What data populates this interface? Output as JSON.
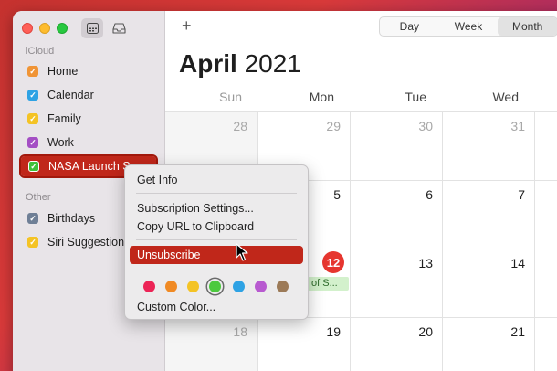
{
  "sidebar": {
    "sections": [
      {
        "title": "iCloud",
        "items": [
          {
            "label": "Home",
            "color": "#f09436"
          },
          {
            "label": "Calendar",
            "color": "#2ea2e4"
          },
          {
            "label": "Family",
            "color": "#f4c325"
          },
          {
            "label": "Work",
            "color": "#a44ec4"
          },
          {
            "label": "NASA Launch S",
            "color": "#3fc13b",
            "selected": true
          }
        ]
      },
      {
        "title": "Other",
        "items": [
          {
            "label": "Birthdays",
            "color": "#6f7f96"
          },
          {
            "label": "Siri Suggestion",
            "color": "#f4c325"
          }
        ]
      }
    ]
  },
  "toolbar": {
    "add": "+",
    "views": [
      "Day",
      "Week",
      "Month"
    ],
    "active_view": "Month"
  },
  "calendar": {
    "month": "April",
    "year": "2021",
    "weekdays": [
      "Sun",
      "Mon",
      "Tue",
      "Wed"
    ],
    "rows": [
      [
        "28",
        "29",
        "30",
        "31"
      ],
      [
        "",
        "5",
        "6",
        "7"
      ],
      [
        "",
        "12",
        "13",
        "14"
      ],
      [
        "18",
        "19",
        "20",
        "21"
      ]
    ],
    "today": "12",
    "event_label": "of S..."
  },
  "context_menu": {
    "get_info": "Get Info",
    "subscription_settings": "Subscription Settings...",
    "copy_url": "Copy URL to Clipboard",
    "unsubscribe": "Unsubscribe",
    "custom_color": "Custom Color...",
    "colors": [
      "#ec2456",
      "#f08a24",
      "#f4c325",
      "#4cc93e",
      "#2ea2e4",
      "#b85ad0",
      "#9c7a58"
    ],
    "selected_color": "#4cc93e"
  }
}
